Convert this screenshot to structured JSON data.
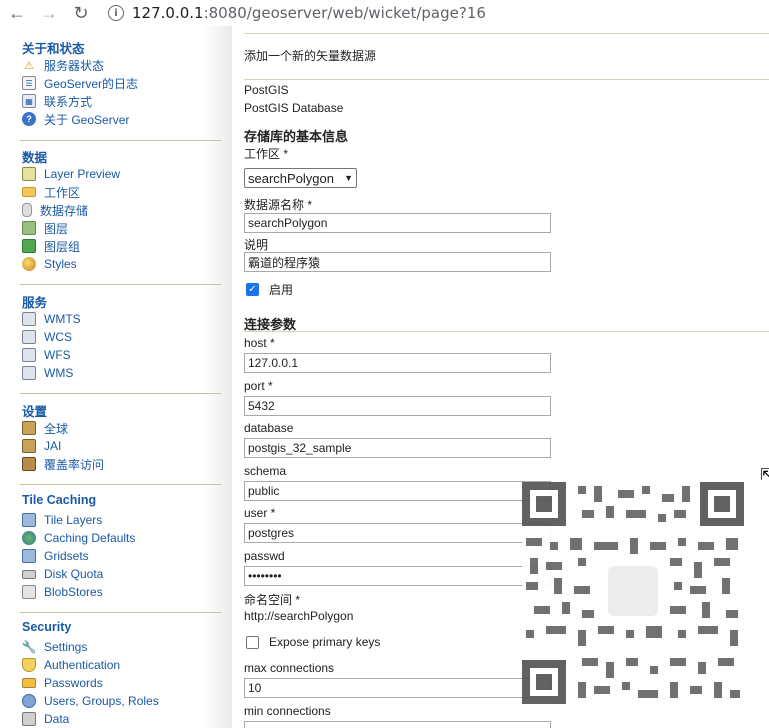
{
  "browser": {
    "url_host": "127.0.0.1",
    "url_path": ":8080/geoserver/web/wicket/page?16"
  },
  "sidebar": {
    "sections": [
      {
        "title": "关于和状态",
        "items": [
          "服务器状态",
          "GeoServer的日志",
          "联系方式",
          "关于 GeoServer"
        ]
      },
      {
        "title": "数据",
        "items": [
          "Layer Preview",
          "工作区",
          "数据存储",
          "图层",
          "图层组",
          "Styles"
        ]
      },
      {
        "title": "服务",
        "items": [
          "WMTS",
          "WCS",
          "WFS",
          "WMS"
        ]
      },
      {
        "title": "设置",
        "items": [
          "全球",
          "JAI",
          "覆盖率访问"
        ]
      },
      {
        "title": "Tile Caching",
        "items": [
          "Tile Layers",
          "Caching Defaults",
          "Gridsets",
          "Disk Quota",
          "BlobStores"
        ]
      },
      {
        "title": "Security",
        "items": [
          "Settings",
          "Authentication",
          "Passwords",
          "Users, Groups, Roles",
          "Data"
        ]
      }
    ]
  },
  "main": {
    "description": "添加一个新的矢量数据源",
    "store_type": "PostGIS",
    "store_type_desc": "PostGIS Database",
    "basic_info_title": "存储库的基本信息",
    "workspace_label": "工作区 *",
    "workspace_value": "searchPolygon",
    "datasource_name_label": "数据源名称 *",
    "datasource_name_value": "searchPolygon",
    "description_label": "说明",
    "description_value": "霸道的程序猿",
    "enabled_label": "启用",
    "connection_title": "连接参数",
    "host_label": "host *",
    "host_value": "127.0.0.1",
    "port_label": "port *",
    "port_value": "5432",
    "database_label": "database",
    "database_value": "postgis_32_sample",
    "schema_label": "schema",
    "schema_value": "public",
    "user_label": "user *",
    "user_value": "postgres",
    "passwd_label": "passwd",
    "passwd_value": "••••••••",
    "namespace_label": "命名空间 *",
    "namespace_value": "http://searchPolygon",
    "expose_pk_label": "Expose primary keys",
    "max_conn_label": "max connections",
    "max_conn_value": "10",
    "min_conn_label": "min connections"
  }
}
